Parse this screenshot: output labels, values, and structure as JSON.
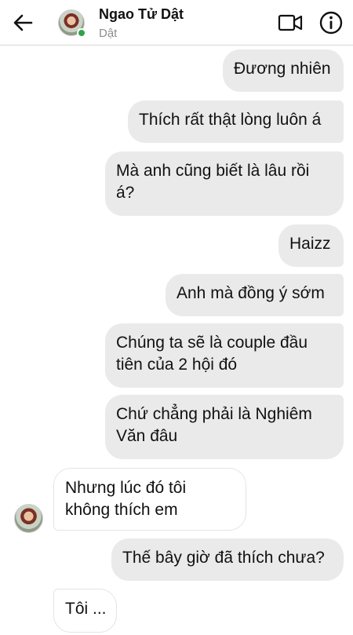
{
  "header": {
    "contact_name": "Ngao Tử Dật",
    "contact_subtitle": "Dật",
    "back_icon": "arrow-left-icon",
    "video_icon": "video-camera-icon",
    "info_icon": "info-icon",
    "online_color": "#31a24c"
  },
  "messages": [
    {
      "direction": "out",
      "text": "Đương nhiên"
    },
    {
      "direction": "out",
      "text": "Thích rất thật lòng luôn á"
    },
    {
      "direction": "out",
      "lines": [
        "Mà anh cũng biết là lâu rồi",
        "á?"
      ]
    },
    {
      "direction": "out",
      "text": "Haizz"
    },
    {
      "direction": "out",
      "text": "Anh mà đồng ý sớm"
    },
    {
      "direction": "out",
      "lines": [
        "Chúng ta sẽ là couple đầu",
        "tiên của 2 hội đó"
      ]
    },
    {
      "direction": "out",
      "lines": [
        "Chứ chẳng phải là Nghiêm",
        "Văn đâu"
      ]
    },
    {
      "direction": "in",
      "lines": [
        "Nhưng lúc đó tôi",
        "không thích em"
      ]
    },
    {
      "direction": "out",
      "text": "Thế bây giờ đã thích chưa?"
    },
    {
      "direction": "in",
      "text": "Tôi ..."
    }
  ]
}
